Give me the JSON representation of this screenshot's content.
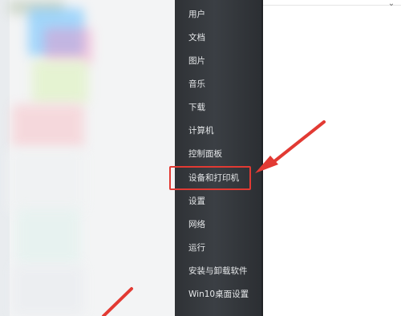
{
  "start_menu": {
    "items": [
      {
        "label": "用户"
      },
      {
        "label": "文档"
      },
      {
        "label": "图片"
      },
      {
        "label": "音乐"
      },
      {
        "label": "下载"
      },
      {
        "label": "计算机"
      },
      {
        "label": "控制面板"
      },
      {
        "label": "设备和打印机"
      },
      {
        "label": "设置"
      },
      {
        "label": "网络"
      },
      {
        "label": "运行"
      },
      {
        "label": "安装与卸载软件"
      },
      {
        "label": "Win10桌面设置"
      }
    ],
    "highlighted_item": "设备和打印机"
  },
  "annotations": {
    "highlight_color": "#e23a33",
    "panel_color": "#35393d"
  }
}
